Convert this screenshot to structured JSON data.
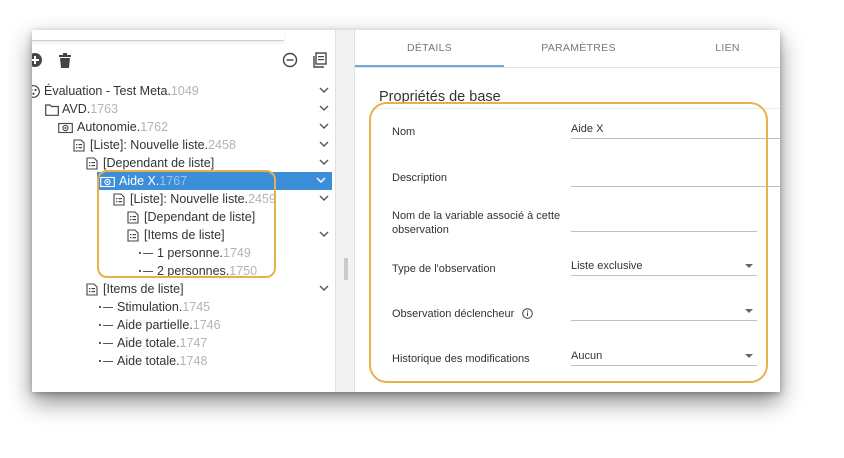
{
  "toolbar": {
    "add_icon": "add-circle-icon",
    "delete_icon": "trash-icon",
    "collapse_icon": "minus-circle-icon",
    "copy_icon": "copy-icon"
  },
  "tree": {
    "items": [
      {
        "label": "Évaluation - Test Meta.",
        "num": "1049",
        "icon": "evaluation-icon"
      },
      {
        "label": "AVD.",
        "num": "1763",
        "icon": "folder-icon"
      },
      {
        "label": "Autonomie.",
        "num": "1762",
        "icon": "observation-icon"
      },
      {
        "label": "[Liste]: Nouvelle liste.",
        "num": "2458",
        "icon": "list-icon"
      },
      {
        "label": "[Dependant de liste]",
        "num": "",
        "icon": "list-icon"
      },
      {
        "label": "Aide X.",
        "num": "1767",
        "icon": "observation-icon"
      },
      {
        "label": "[Liste]: Nouvelle liste.",
        "num": "2459",
        "icon": "list-icon"
      },
      {
        "label": "[Dependant de liste]",
        "num": "",
        "icon": "list-icon"
      },
      {
        "label": "[Items de liste]",
        "num": "",
        "icon": "list-icon"
      },
      {
        "label": "1 personne.",
        "num": "1749",
        "icon": "item-icon"
      },
      {
        "label": "2 personnes.",
        "num": "1750",
        "icon": "item-icon"
      },
      {
        "label": "[Items de liste]",
        "num": "",
        "icon": "list-icon"
      },
      {
        "label": "Stimulation.",
        "num": "1745",
        "icon": "item-icon"
      },
      {
        "label": "Aide partielle.",
        "num": "1746",
        "icon": "item-icon"
      },
      {
        "label": "Aide totale.",
        "num": "1747",
        "icon": "item-icon"
      },
      {
        "label": "Aide totale.",
        "num": "1748",
        "icon": "item-icon"
      }
    ]
  },
  "tabs": [
    {
      "label": "DÉTAILS",
      "active": true
    },
    {
      "label": "PARAMÈTRES",
      "active": false
    },
    {
      "label": "LIEN",
      "active": false
    }
  ],
  "details": {
    "section_title": "Propriétés de base",
    "fields": [
      {
        "label": "Nom",
        "value": "Aide X"
      },
      {
        "label": "Description",
        "value": ""
      },
      {
        "label": "Nom de la variable associé à cette observation",
        "value": ""
      },
      {
        "label": "Type de l'observation",
        "value": "Liste exclusive"
      },
      {
        "label": "Observation déclencheur",
        "value": ""
      },
      {
        "label": "Historique des modifications",
        "value": "Aucun"
      }
    ],
    "info_icon": "info-icon"
  },
  "colors": {
    "selected": "#3d8ed8",
    "highlight": "#e8b04b",
    "tab_underline": "#6ea7dc"
  }
}
